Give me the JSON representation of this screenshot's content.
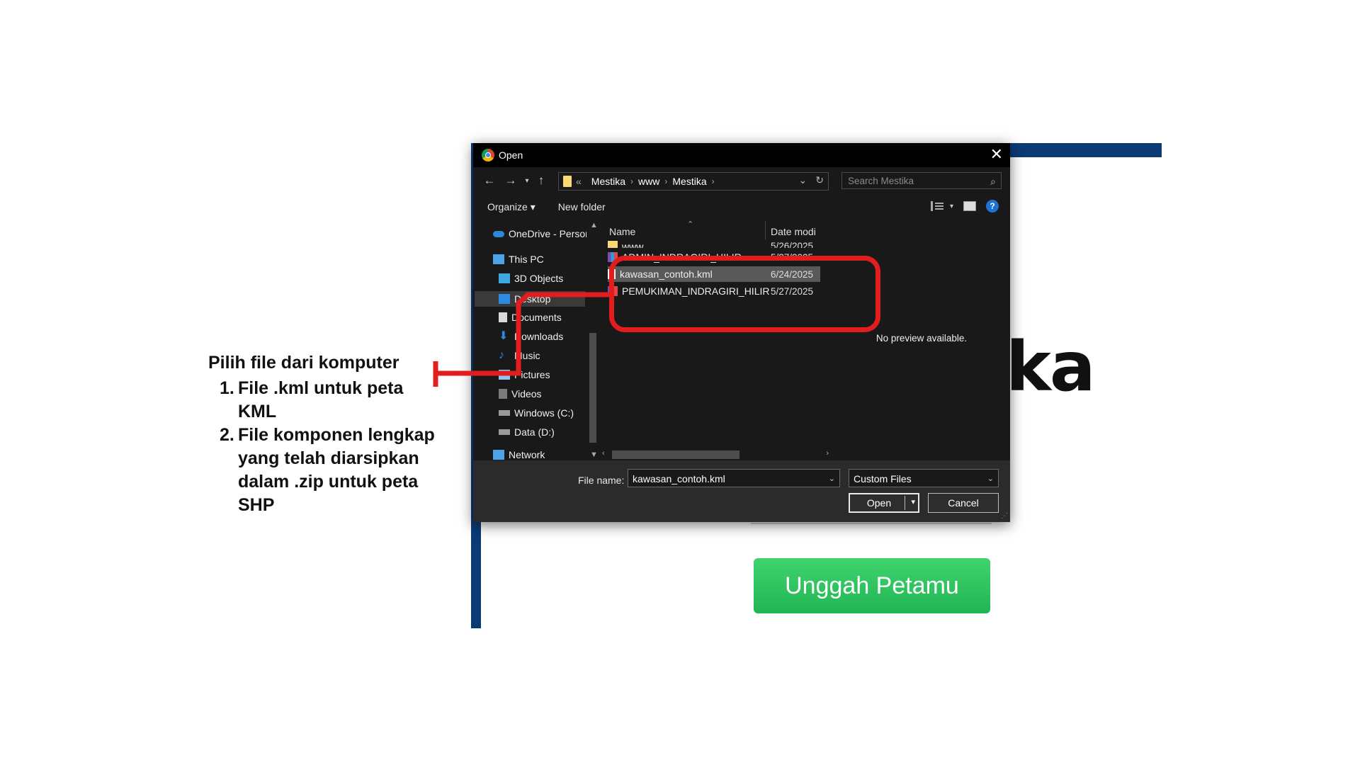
{
  "background_page": {
    "title_fragment": "ka",
    "upload_button": "Unggah Petamu"
  },
  "dialog": {
    "title": "Open",
    "nav": {
      "back": "←",
      "forward": "→",
      "up": "↑",
      "breadcrumb": [
        "«",
        "Mestika",
        "www",
        "Mestika"
      ],
      "refresh": "↻",
      "search_placeholder": "Search Mestika"
    },
    "toolbar": {
      "organize": "Organize ▾",
      "new_folder": "New folder"
    },
    "sidebar": [
      {
        "label": "OneDrive - Persor",
        "icon": "cloud-icon"
      },
      {
        "label": "This PC",
        "icon": "pc-icon"
      },
      {
        "label": "3D Objects",
        "icon": "cube-icon"
      },
      {
        "label": "Desktop",
        "icon": "desktop-icon"
      },
      {
        "label": "Documents",
        "icon": "document-icon"
      },
      {
        "label": "Downloads",
        "icon": "download-icon"
      },
      {
        "label": "Music",
        "icon": "music-icon"
      },
      {
        "label": "Pictures",
        "icon": "picture-icon"
      },
      {
        "label": "Videos",
        "icon": "video-icon"
      },
      {
        "label": "Windows (C:)",
        "icon": "drive-icon"
      },
      {
        "label": "Data (D:)",
        "icon": "drive-icon"
      },
      {
        "label": "Network",
        "icon": "network-icon"
      }
    ],
    "columns": {
      "name": "Name",
      "date": "Date modi"
    },
    "files": [
      {
        "name": "www",
        "date": "5/26/2025",
        "type": "folder"
      },
      {
        "name": "ADMIN_INDRAGIRI_HILIR",
        "date": "5/27/2025",
        "type": "archive"
      },
      {
        "name": "kawasan_contoh.kml",
        "date": "6/24/2025",
        "type": "file",
        "selected": true
      },
      {
        "name": "PEMUKIMAN_INDRAGIRI_HILIR",
        "date": "5/27/2025",
        "type": "archive"
      }
    ],
    "preview_text": "No preview available.",
    "file_name_label": "File name:",
    "file_name_value": "kawasan_contoh.kml",
    "file_type": "Custom Files",
    "open_label": "Open",
    "cancel_label": "Cancel"
  },
  "annotation": {
    "title": "Pilih file dari komputer",
    "items": [
      {
        "num": "1.",
        "text": "File .kml untuk peta KML"
      },
      {
        "num": "2.",
        "text": "File komponen lengkap yang telah diarsipkan dalam .zip untuk peta SHP"
      }
    ],
    "highlight_color": "#e21d1d"
  }
}
